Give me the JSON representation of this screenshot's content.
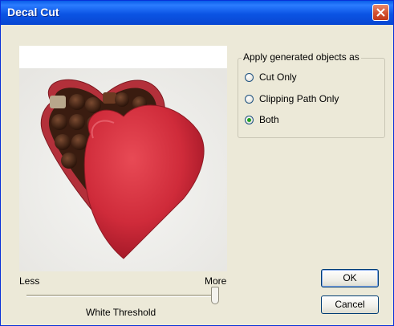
{
  "window": {
    "title": "Decal Cut"
  },
  "group": {
    "label": "Apply generated objects as",
    "options": [
      "Cut Only",
      "Clipping Path Only",
      "Both"
    ],
    "selected": "Both"
  },
  "slider": {
    "min_label": "Less",
    "max_label": "More",
    "caption": "White Threshold",
    "value_fraction": 1.0
  },
  "buttons": {
    "ok": "OK",
    "cancel": "Cancel"
  }
}
